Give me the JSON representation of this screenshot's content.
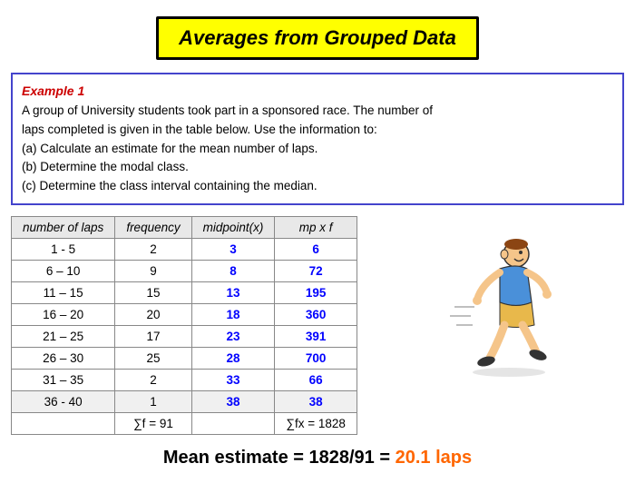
{
  "title": "Averages from Grouped Data",
  "example": {
    "label": "Example 1",
    "text1": "A group of University students took part in a sponsored race. The number of",
    "text2": "laps completed is given in the table below. Use the information to:",
    "text3": "(a) Calculate an estimate for the mean number of laps.",
    "text4": "(b) Determine the modal class.",
    "text5": "(c) Determine the class interval containing the median."
  },
  "table": {
    "headers": [
      "number of laps",
      "frequency",
      "midpoint(x)",
      "mp x f"
    ],
    "rows": [
      {
        "laps": "1 - 5",
        "freq": "2",
        "mid": "3",
        "mpf": "6"
      },
      {
        "laps": "6 – 10",
        "freq": "9",
        "mid": "8",
        "mpf": "72"
      },
      {
        "laps": "11 – 15",
        "freq": "15",
        "mid": "13",
        "mpf": "195"
      },
      {
        "laps": "16 – 20",
        "freq": "20",
        "mid": "18",
        "mpf": "360"
      },
      {
        "laps": "21 – 25",
        "freq": "17",
        "mid": "23",
        "mpf": "391"
      },
      {
        "laps": "26 – 30",
        "freq": "25",
        "mid": "28",
        "mpf": "700"
      },
      {
        "laps": "31 – 35",
        "freq": "2",
        "mid": "33",
        "mpf": "66"
      },
      {
        "laps": "36 - 40",
        "freq": "1",
        "mid": "38",
        "mpf": "38"
      }
    ],
    "sum_freq": "∑f = 91",
    "sum_mpf": "∑fx = 1828"
  },
  "mean_prefix": "Mean estimate = 1828/91 = ",
  "mean_value": "20.1 laps"
}
